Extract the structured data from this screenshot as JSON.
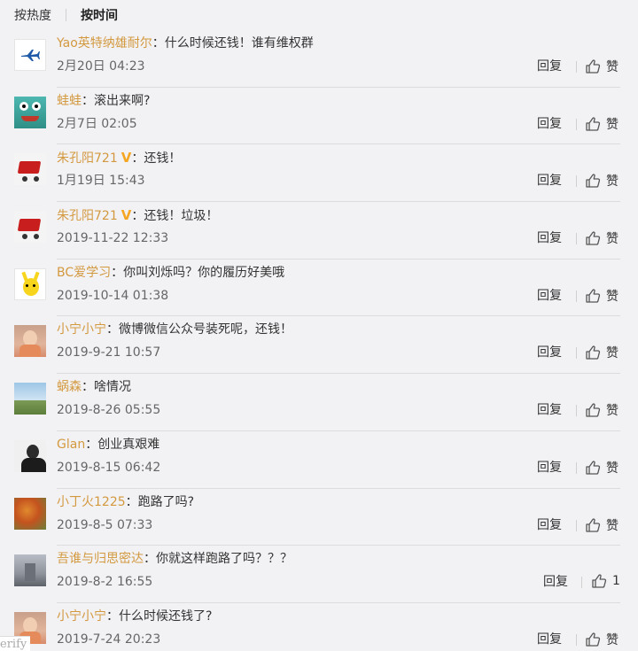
{
  "sort": {
    "hot": "按热度",
    "time": "按时间"
  },
  "actions": {
    "reply": "回复",
    "like": "赞"
  },
  "colon": "：",
  "comments": [
    {
      "user": "Yao英特纳雄耐尔",
      "verified": false,
      "text": "什么时候还钱！谁有维权群",
      "time": "2月20日 04:23",
      "likes": "赞",
      "avatar": "plane"
    },
    {
      "user": "蛙蛙",
      "verified": false,
      "text": "滚出来啊?",
      "time": "2月7日 02:05",
      "likes": "赞",
      "avatar": "frog"
    },
    {
      "user": "朱孔阳721",
      "verified": true,
      "text": "还钱！",
      "time": "1月19日 15:43",
      "likes": "赞",
      "avatar": "cart"
    },
    {
      "user": "朱孔阳721",
      "verified": true,
      "text": "还钱！垃圾！",
      "time": "2019-11-22 12:33",
      "likes": "赞",
      "avatar": "cart"
    },
    {
      "user": "BC爱学习",
      "verified": false,
      "text": "你叫刘烁吗？你的履历好美哦",
      "time": "2019-10-14 01:38",
      "likes": "赞",
      "avatar": "pikachu"
    },
    {
      "user": "小宁小宁",
      "verified": false,
      "text": "微博微信公众号装死呢，还钱！",
      "time": "2019-9-21 10:57",
      "likes": "赞",
      "avatar": "girl"
    },
    {
      "user": "蜗森",
      "verified": false,
      "text": "啥情况",
      "time": "2019-8-26 05:55",
      "likes": "赞",
      "avatar": "landscape"
    },
    {
      "user": "Glan",
      "verified": false,
      "text": "创业真艰难",
      "time": "2019-8-15 06:42",
      "likes": "赞",
      "avatar": "man"
    },
    {
      "user": "小丁火1225",
      "verified": false,
      "text": "跑路了吗?",
      "time": "2019-8-5 07:33",
      "likes": "赞",
      "avatar": "tree"
    },
    {
      "user": "吾谁与归思密达",
      "verified": false,
      "text": "你就这样跑路了吗？？？",
      "time": "2019-8-2 16:55",
      "likes": "1",
      "avatar": "street"
    },
    {
      "user": "小宁小宁",
      "verified": false,
      "text": "什么时候还钱了?",
      "time": "2019-7-24 20:23",
      "likes": "赞",
      "avatar": "girl"
    }
  ],
  "watermark": "erify",
  "verified_badge": "V"
}
